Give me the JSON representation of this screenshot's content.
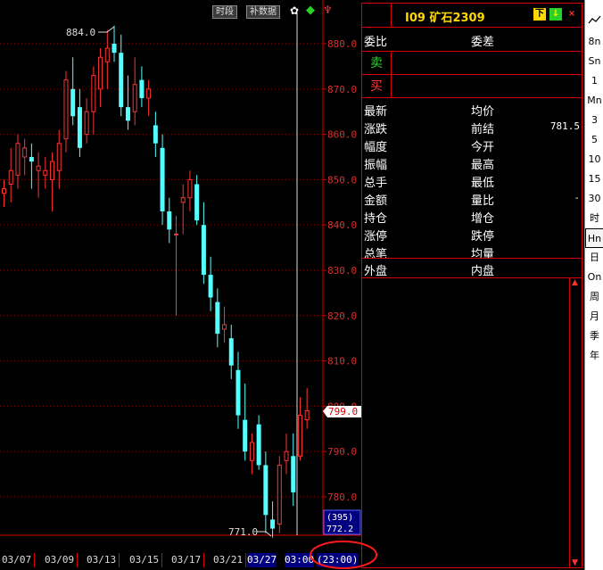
{
  "chart": {
    "toolbar": {
      "time_share": "时段",
      "fill_data": "补数据"
    },
    "high_label": "884.0",
    "low_label": "771.0",
    "current_price": "799.0",
    "volume_tag": "(395)",
    "crosshair_price": "772.2",
    "time_readout": "(23:00)"
  },
  "chart_data": {
    "type": "candlestick",
    "symbol": "I09 矿石2309",
    "y_ticks": [
      "880.0",
      "870.0",
      "860.0",
      "850.0",
      "840.0",
      "830.0",
      "820.0",
      "810.0",
      "800.0",
      "790.0",
      "780.0"
    ],
    "ylim": [
      771,
      884
    ],
    "x_ticks": [
      "03/07",
      "03/09",
      "03/13",
      "03/15",
      "03/17",
      "03/21",
      "03/27",
      "03:00"
    ],
    "colors": {
      "up": "#ff3333",
      "down": "#54ffff"
    },
    "candles": [
      {
        "o": 847,
        "h": 850,
        "l": 844,
        "c": 848
      },
      {
        "o": 849,
        "h": 857,
        "l": 845,
        "c": 852
      },
      {
        "o": 851,
        "h": 860,
        "l": 848,
        "c": 858
      },
      {
        "o": 855,
        "h": 859,
        "l": 851,
        "c": 857
      },
      {
        "o": 855,
        "h": 858,
        "l": 848,
        "c": 854
      },
      {
        "o": 852,
        "h": 856,
        "l": 846,
        "c": 853
      },
      {
        "o": 851,
        "h": 855,
        "l": 848,
        "c": 852
      },
      {
        "o": 850,
        "h": 856,
        "l": 843,
        "c": 854
      },
      {
        "o": 852,
        "h": 861,
        "l": 848,
        "c": 858
      },
      {
        "o": 859,
        "h": 874,
        "l": 856,
        "c": 872
      },
      {
        "o": 870,
        "h": 877,
        "l": 862,
        "c": 864
      },
      {
        "o": 866,
        "h": 870,
        "l": 855,
        "c": 857
      },
      {
        "o": 860,
        "h": 868,
        "l": 858,
        "c": 865
      },
      {
        "o": 865,
        "h": 875,
        "l": 860,
        "c": 873
      },
      {
        "o": 870,
        "h": 879,
        "l": 866,
        "c": 877
      },
      {
        "o": 876,
        "h": 883,
        "l": 870,
        "c": 879
      },
      {
        "o": 880,
        "h": 884,
        "l": 876,
        "c": 878
      },
      {
        "o": 878,
        "h": 882,
        "l": 864,
        "c": 866
      },
      {
        "o": 866,
        "h": 873,
        "l": 861,
        "c": 863
      },
      {
        "o": 865,
        "h": 877,
        "l": 862,
        "c": 871
      },
      {
        "o": 872,
        "h": 875,
        "l": 866,
        "c": 868
      },
      {
        "o": 868,
        "h": 872,
        "l": 864,
        "c": 870
      },
      {
        "o": 862,
        "h": 865,
        "l": 855,
        "c": 858
      },
      {
        "o": 857,
        "h": 860,
        "l": 840,
        "c": 843
      },
      {
        "o": 843,
        "h": 846,
        "l": 836,
        "c": 839
      },
      {
        "o": 838,
        "h": 842,
        "l": 820,
        "c": 838
      },
      {
        "o": 845,
        "h": 849,
        "l": 838,
        "c": 846
      },
      {
        "o": 846,
        "h": 852,
        "l": 843,
        "c": 850
      },
      {
        "o": 849,
        "h": 851,
        "l": 840,
        "c": 841
      },
      {
        "o": 840,
        "h": 845,
        "l": 827,
        "c": 829
      },
      {
        "o": 829,
        "h": 833,
        "l": 821,
        "c": 824
      },
      {
        "o": 823,
        "h": 826,
        "l": 813,
        "c": 816
      },
      {
        "o": 817,
        "h": 822,
        "l": 814,
        "c": 818
      },
      {
        "o": 815,
        "h": 818,
        "l": 806,
        "c": 809
      },
      {
        "o": 808,
        "h": 812,
        "l": 795,
        "c": 798
      },
      {
        "o": 797,
        "h": 805,
        "l": 788,
        "c": 790
      },
      {
        "o": 788,
        "h": 794,
        "l": 785,
        "c": 792
      },
      {
        "o": 796,
        "h": 798,
        "l": 786,
        "c": 787
      },
      {
        "o": 787,
        "h": 790,
        "l": 772,
        "c": 776
      },
      {
        "o": 775,
        "h": 779,
        "l": 771,
        "c": 773
      },
      {
        "o": 774,
        "h": 789,
        "l": 772,
        "c": 787
      },
      {
        "o": 788,
        "h": 794,
        "l": 785,
        "c": 790
      },
      {
        "o": 789,
        "h": 794,
        "l": 778,
        "c": 781
      },
      {
        "o": 789,
        "h": 802,
        "l": 788,
        "c": 798
      },
      {
        "o": 797,
        "h": 804,
        "l": 795,
        "c": 799
      }
    ]
  },
  "quote": {
    "title": "I09 矿石2309",
    "icons": [
      "下",
      "↓",
      "×"
    ],
    "commission_ratio": "委比",
    "commission_diff": "委差",
    "sell": "卖",
    "buy": "买",
    "rows": [
      {
        "l": "最新",
        "r": "均价",
        "v": ""
      },
      {
        "l": "涨跌",
        "r": "前结",
        "v": "781.5"
      },
      {
        "l": "幅度",
        "r": "今开",
        "v": ""
      },
      {
        "l": "振幅",
        "r": "最高",
        "v": ""
      },
      {
        "l": "总手",
        "r": "最低",
        "v": ""
      },
      {
        "l": "金额",
        "r": "量比",
        "v": "-"
      },
      {
        "l": "持仓",
        "r": "增仓",
        "v": ""
      },
      {
        "l": "涨停",
        "r": "跌停",
        "v": ""
      },
      {
        "l": "总笔",
        "r": "均量",
        "v": ""
      }
    ],
    "outer": "外盘",
    "inner": "内盘"
  },
  "periods": [
    "8n",
    "Sn",
    "1",
    "Mn",
    "3",
    "5",
    "10",
    "15",
    "30",
    "时",
    "Hn",
    "日",
    "On",
    "周",
    "月",
    "季",
    "年"
  ],
  "active_period": "Hn"
}
